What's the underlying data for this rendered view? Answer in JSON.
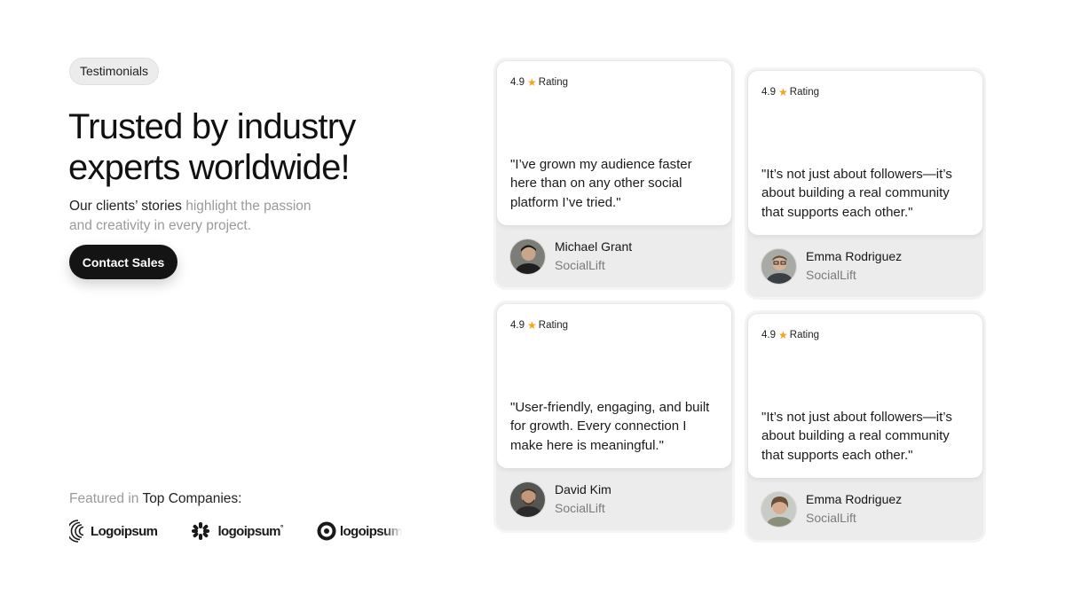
{
  "badge": "Testimonials",
  "headline": "Trusted by industry experts worldwide!",
  "subtext": {
    "dark": "Our clients’ stories ",
    "light": "highlight the passion and creativity in every project."
  },
  "cta_label": "Contact Sales",
  "featured": {
    "light": "Featured in ",
    "dark": "Top Companies:"
  },
  "logos": [
    {
      "name": "Logoipsum",
      "icon": "concentric-arcs-icon"
    },
    {
      "name": "logoipsum",
      "trademark": "°",
      "icon": "starburst-icon"
    },
    {
      "name": "logoipsum",
      "icon": "ring-icon"
    }
  ],
  "testimonials": [
    {
      "rating": "4.9",
      "rating_label": "Rating",
      "quote": "\"I’ve grown my audience faster here than on any other social platform I’ve tried.\"",
      "name": "Michael Grant",
      "company": "SocialLift"
    },
    {
      "rating": "4.9",
      "rating_label": "Rating",
      "quote": "\"It’s not just about followers—it’s about building a real community that supports each other.\"",
      "name": "Emma Rodriguez",
      "company": "SocialLift"
    },
    {
      "rating": "4.9",
      "rating_label": "Rating",
      "quote": "\"User-friendly, engaging, and built for growth. Every connection I make here is meaningful.\"",
      "name": "David Kim",
      "company": "SocialLift"
    },
    {
      "rating": "4.9",
      "rating_label": "Rating",
      "quote": "\"It’s not just about followers—it’s about building a real community that supports each other.\"",
      "name": "Emma Rodriguez",
      "company": "SocialLift"
    }
  ],
  "colors": {
    "star": "#f2a516",
    "button_bg": "#141414",
    "card_bg": "#ececec",
    "muted_text": "#9a9a9a"
  }
}
